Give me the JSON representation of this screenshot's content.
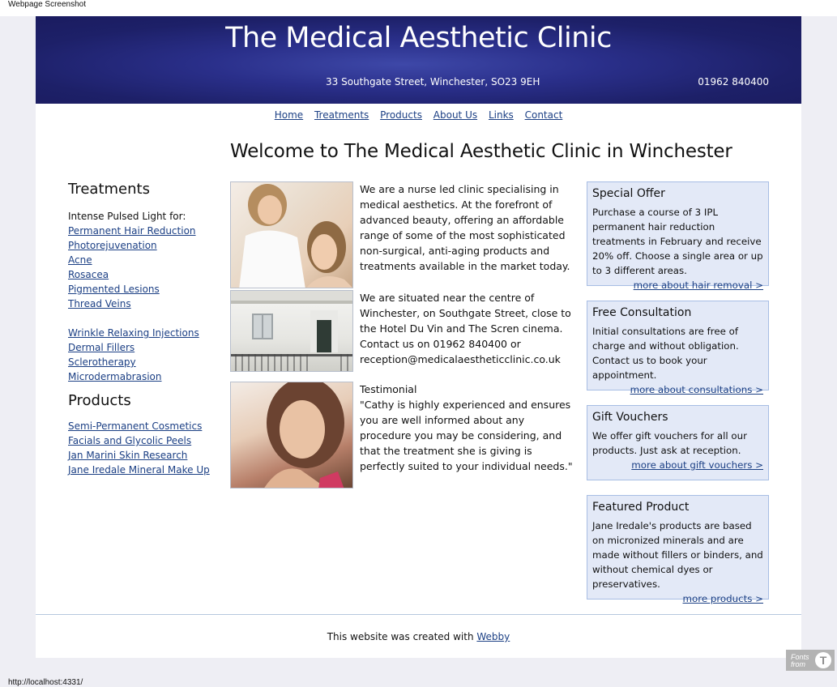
{
  "window": {
    "caption": "Webpage Screenshot",
    "status_url": "http://localhost:4331/"
  },
  "header": {
    "title": "The Medical Aesthetic Clinic",
    "address": "33 Southgate Street, Winchester, SO23 9EH",
    "phone": "01962 840400"
  },
  "nav": [
    "Home",
    "Treatments",
    "Products",
    "About Us",
    "Links",
    "Contact"
  ],
  "welcome": "Welcome to The Medical Aesthetic Clinic in Winchester",
  "sidebar": {
    "treatments_heading": "Treatments",
    "ipl_intro": "Intense Pulsed Light for:",
    "ipl_items": [
      "Permanent Hair Reduction",
      "Photorejuvenation",
      "Acne",
      "Rosacea",
      "Pigmented Lesions",
      "Thread Veins"
    ],
    "other_items": [
      "Wrinkle Relaxing Injections",
      "Dermal Fillers",
      "Sclerotherapy",
      "Microdermabrasion"
    ],
    "products_heading": "Products",
    "product_items": [
      "Semi-Permanent Cosmetics",
      "Facials and Glycolic Peels",
      "Jan Marini Skin Research",
      "Jane Iredale Mineral Make Up"
    ]
  },
  "main": {
    "para1": "We are a nurse led clinic specialising in medical aesthetics. At the forefront of advanced beauty, offering an affordable range of some of the most sophisticated non-surgical, anti-aging products and treatments available in the market today.",
    "para2": "We are situated near the centre of Winchester, on Southgate Street, close to the Hotel Du Vin and The Scren cinema. Contact us on 01962 840400 or reception@medicalaestheticclinic.co.uk",
    "testimonial_label": "Testimonial",
    "testimonial": "\"Cathy is highly experienced and ensures you are well informed about any procedure you may be considering, and that the treatment she is giving is perfectly suited to your individual needs.\""
  },
  "boxes": [
    {
      "title": "Special Offer",
      "text": "Purchase a course of 3 IPL permanent hair reduction treatments in February and receive 20% off. Choose a single area or up to 3 different areas.",
      "link": "more about hair removal >"
    },
    {
      "title": "Free Consultation",
      "text": "Initial consultations are free of charge and without obligation. Contact us to book your appointment.",
      "link": "more about consultations >"
    },
    {
      "title": "Gift Vouchers",
      "text": "We offer gift vouchers for all our products. Just ask at reception.",
      "link": "more about gift vouchers >"
    },
    {
      "title": "Featured Product",
      "text": "Jane Iredale's products are based on micronized minerals and are made without fillers or binders, and without chemical dyes or preservatives.",
      "link": "more products >"
    }
  ],
  "footer": {
    "text": "This website was created with ",
    "link": "Webby"
  },
  "badge": {
    "line1": "Fonts",
    "line2": "from"
  }
}
